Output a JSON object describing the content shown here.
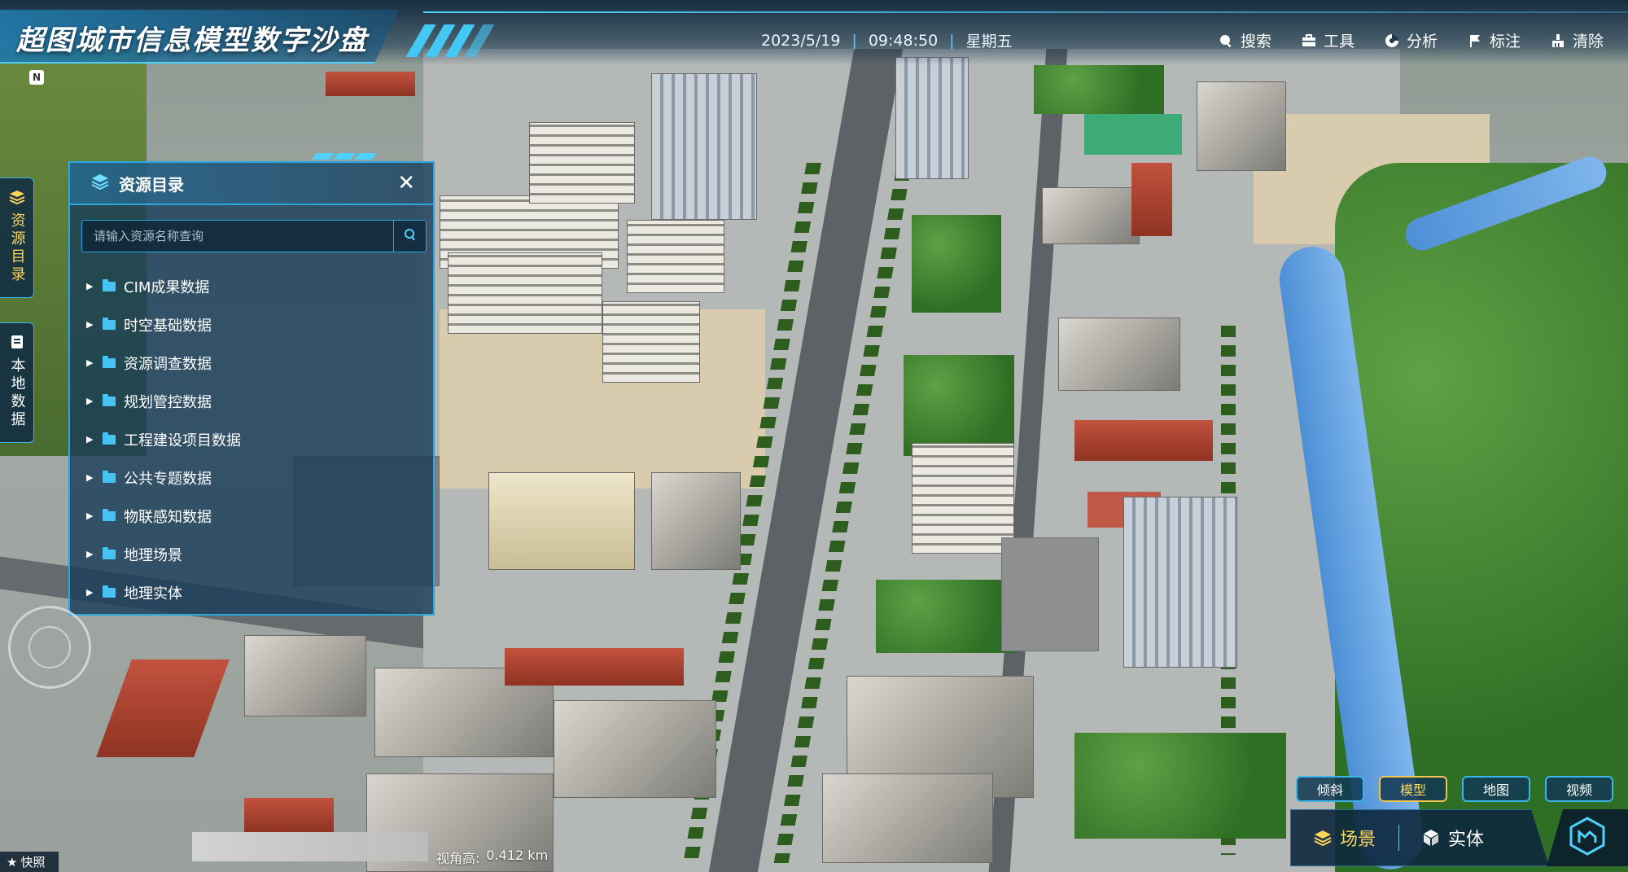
{
  "header": {
    "title": "超图城市信息模型数字沙盘",
    "date": "2023/5/19",
    "time": "09:48:50",
    "weekday": "星期五",
    "separator": "|"
  },
  "toolbar": {
    "items": [
      {
        "label": "搜索",
        "icon": "search-icon"
      },
      {
        "label": "工具",
        "icon": "toolbox-icon"
      },
      {
        "label": "分析",
        "icon": "analysis-icon"
      },
      {
        "label": "标注",
        "icon": "flag-icon"
      },
      {
        "label": "清除",
        "icon": "clear-icon"
      }
    ]
  },
  "side_tabs": {
    "catalog": "资源目录",
    "local": "本地数据"
  },
  "panel": {
    "title": "资源目录",
    "search_placeholder": "请输入资源名称查询",
    "items": [
      {
        "label": "CIM成果数据"
      },
      {
        "label": "时空基础数据"
      },
      {
        "label": "资源调查数据"
      },
      {
        "label": "规划管控数据"
      },
      {
        "label": "工程建设项目数据"
      },
      {
        "label": "公共专题数据"
      },
      {
        "label": "物联感知数据"
      },
      {
        "label": "地理场景"
      },
      {
        "label": "地理实体"
      }
    ]
  },
  "compass": {
    "north": "N"
  },
  "snapshot": {
    "label": "快照",
    "icon": "star-icon"
  },
  "status": {
    "view_height_label": "视角高:",
    "view_height_value": "0.412 km"
  },
  "view_modes": {
    "buttons": [
      {
        "label": "倾斜",
        "active": false
      },
      {
        "label": "模型",
        "active": true
      },
      {
        "label": "地图",
        "active": false
      },
      {
        "label": "视频",
        "active": false
      }
    ]
  },
  "bottom_switch": {
    "scene": "场景",
    "entity": "实体",
    "active": "scene"
  },
  "colors": {
    "accent": "#2ca6df",
    "highlight": "#ffd65a",
    "panel_bg": "#183c58"
  }
}
